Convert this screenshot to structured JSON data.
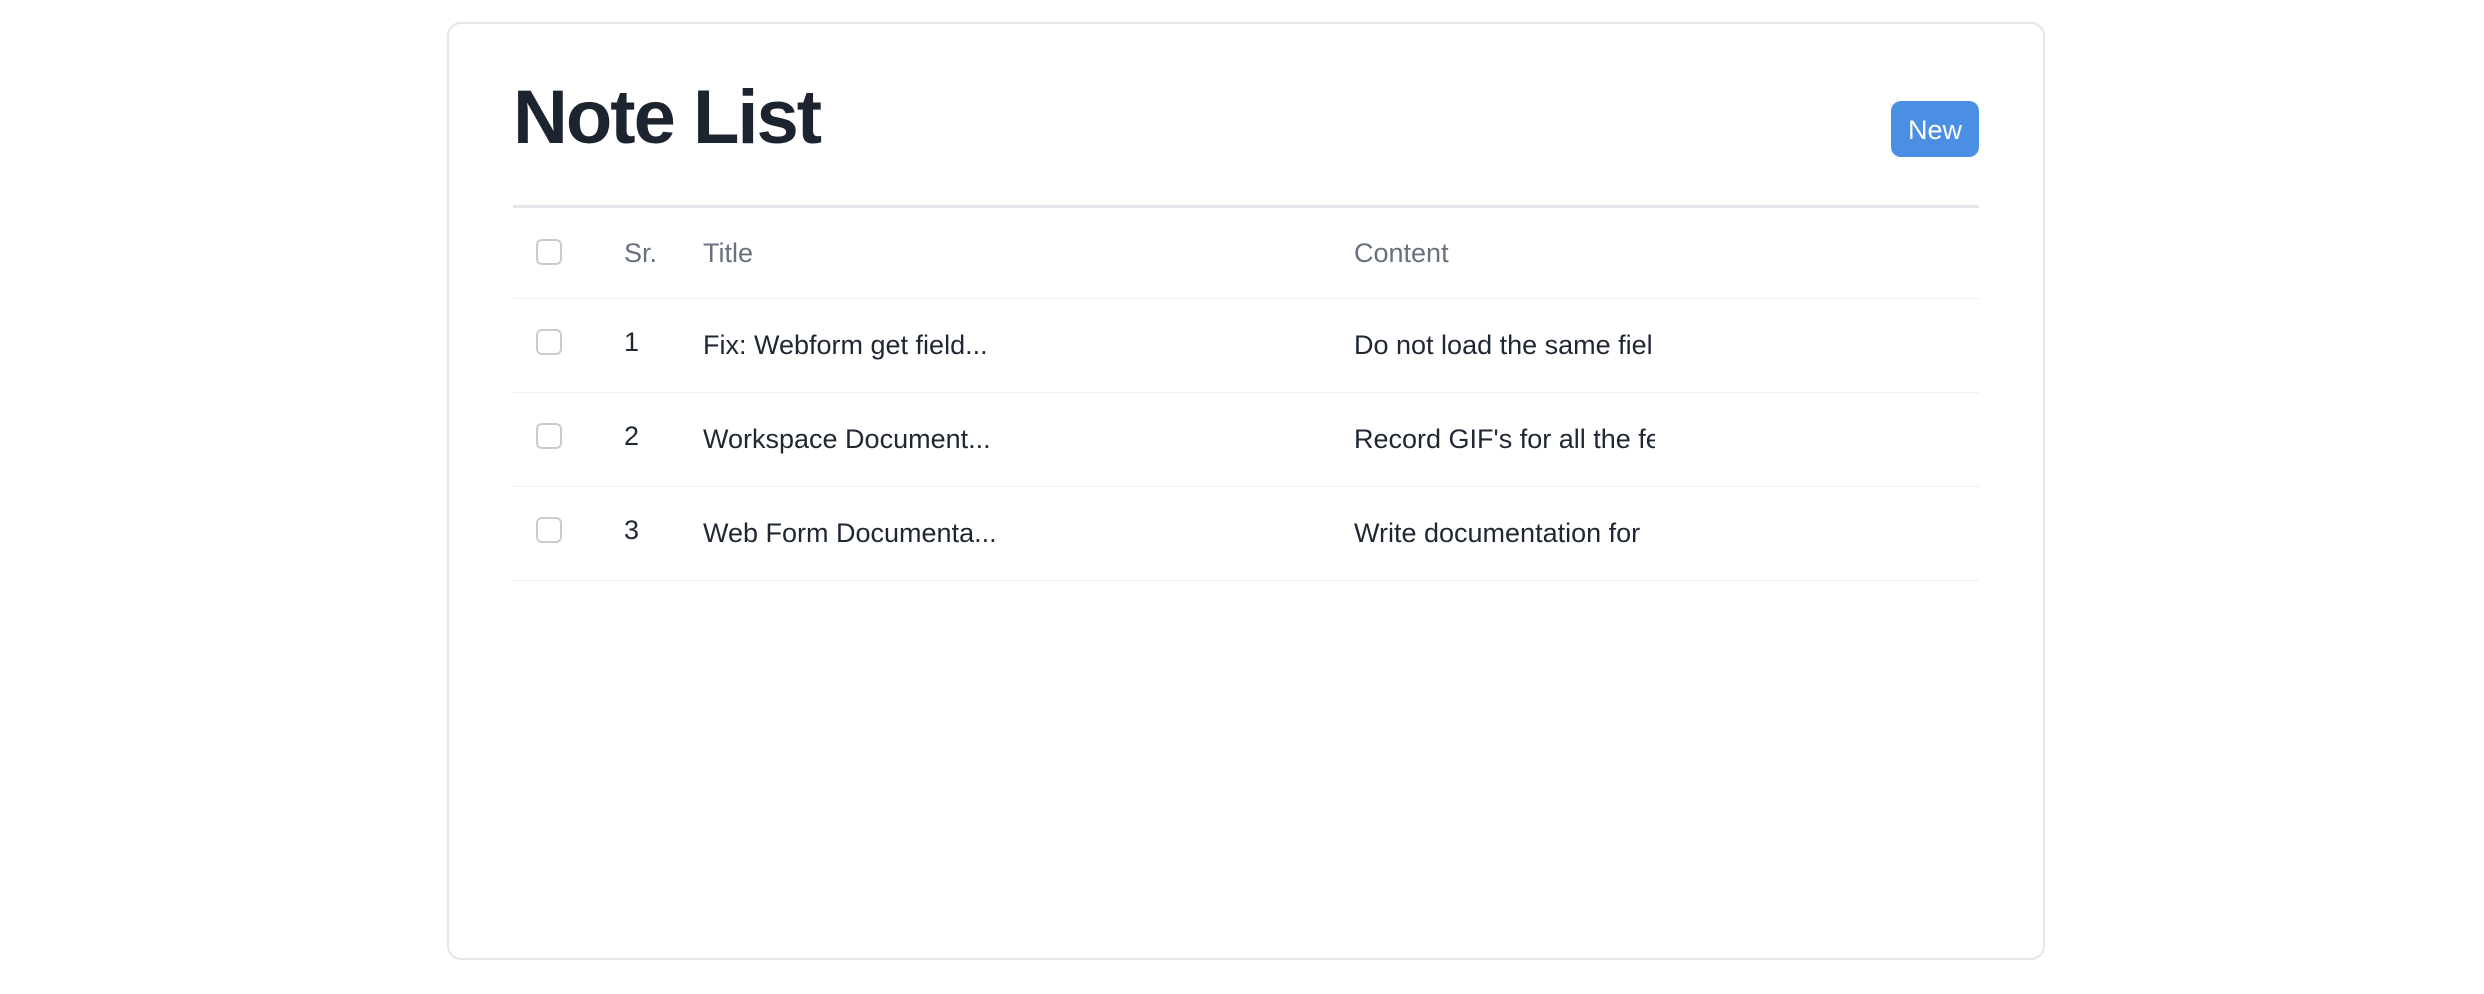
{
  "page": {
    "title": "Note List",
    "new_button_label": "New"
  },
  "table": {
    "columns": {
      "sr": "Sr.",
      "title": "Title",
      "content": "Content"
    },
    "rows": [
      {
        "sr": "1",
        "title": "Fix: Webform get field...",
        "content": "Do not load the same fiel"
      },
      {
        "sr": "2",
        "title": "Workspace Document...",
        "content": "Record GIF's for all the fe"
      },
      {
        "sr": "3",
        "title": "Web Form Documenta...",
        "content": "Write documentation for"
      }
    ]
  },
  "colors": {
    "accent": "#4a8fe4",
    "border": "#e3e6ea"
  }
}
